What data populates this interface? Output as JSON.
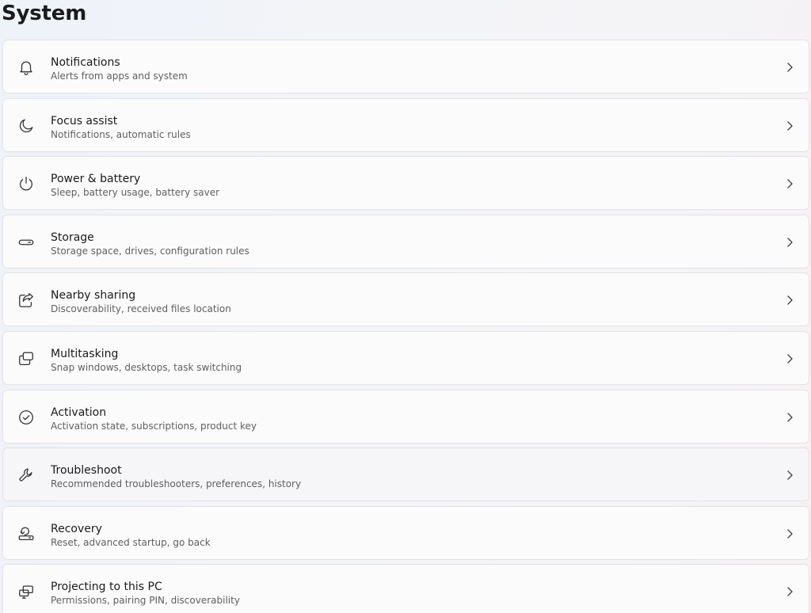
{
  "header": {
    "title": "System"
  },
  "items": [
    {
      "title": "Notifications",
      "subtitle": "Alerts from apps and system",
      "icon": "bell-icon"
    },
    {
      "title": "Focus assist",
      "subtitle": "Notifications, automatic rules",
      "icon": "moon-icon"
    },
    {
      "title": "Power & battery",
      "subtitle": "Sleep, battery usage, battery saver",
      "icon": "power-icon"
    },
    {
      "title": "Storage",
      "subtitle": "Storage space, drives, configuration rules",
      "icon": "storage-drive-icon"
    },
    {
      "title": "Nearby sharing",
      "subtitle": "Discoverability, received files location",
      "icon": "share-icon"
    },
    {
      "title": "Multitasking",
      "subtitle": "Snap windows, desktops, task switching",
      "icon": "multitasking-windows-icon"
    },
    {
      "title": "Activation",
      "subtitle": "Activation state, subscriptions, product key",
      "icon": "check-circle-icon"
    },
    {
      "title": "Troubleshoot",
      "subtitle": "Recommended troubleshooters, preferences, history",
      "icon": "wrench-icon"
    },
    {
      "title": "Recovery",
      "subtitle": "Reset, advanced startup, go back",
      "icon": "recovery-icon"
    },
    {
      "title": "Projecting to this PC",
      "subtitle": "Permissions, pairing PIN, discoverability",
      "icon": "projector-icon"
    }
  ],
  "colors": {
    "card_background": "#fbfbfb",
    "card_border": "#e3e3e6",
    "subtitle_text": "#5f5f5f"
  }
}
